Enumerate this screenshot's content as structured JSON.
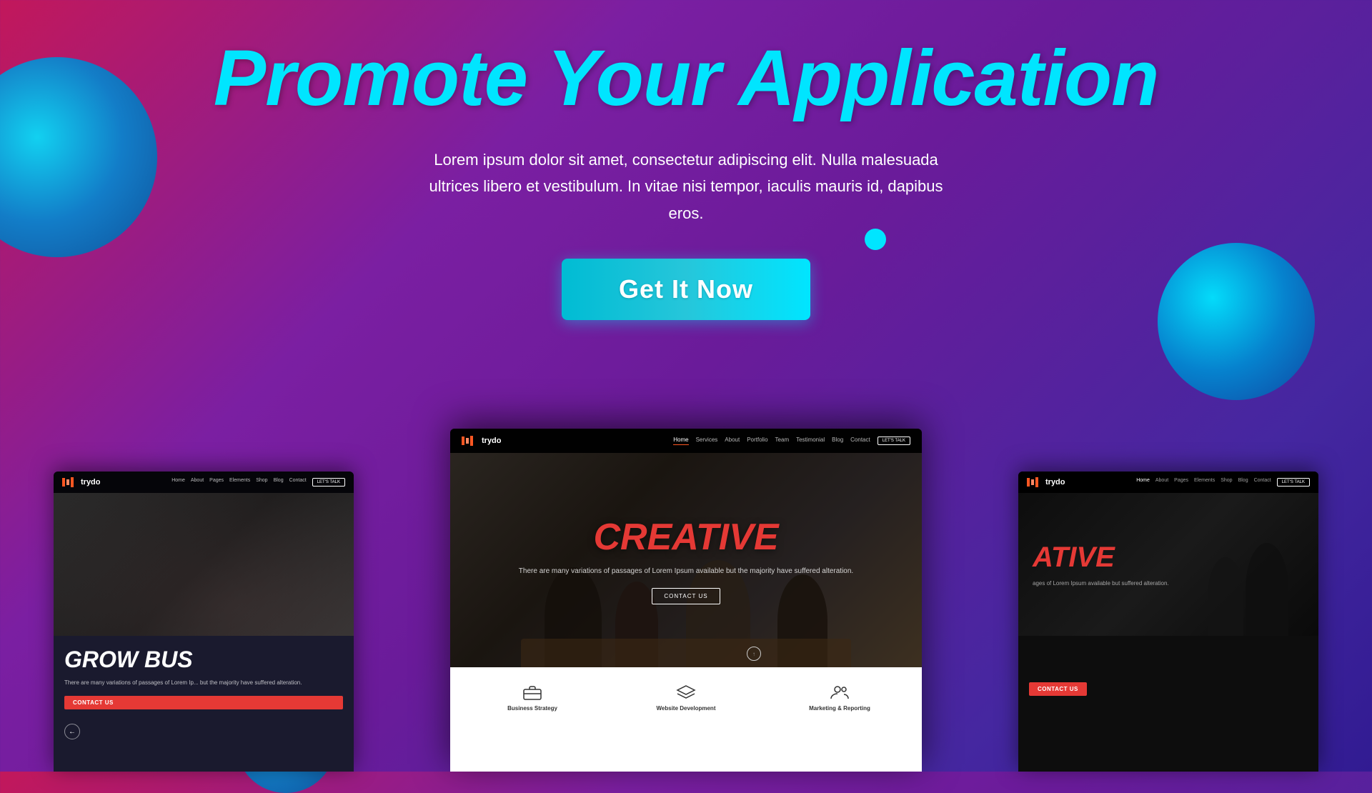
{
  "hero": {
    "title": "Promote Your Application",
    "subtitle": "Lorem ipsum dolor sit amet, consectetur adipiscing elit. Nulla malesuada ultrices libero et vestibulum. In vitae nisi tempor, iaculis mauris id, dapibus eros.",
    "cta_label": "Get It Now"
  },
  "left_screenshot": {
    "logo_text": "trydo",
    "nav_links": [
      "Home",
      "About",
      "Pages",
      "Elements",
      "Shop",
      "Blog",
      "Contact"
    ],
    "cta_nav": "LET'S TALK",
    "heading": "GROW BUS",
    "body_text": "There are many variations of passages of Lorem Ip... but the majority have suffered alteration.",
    "contact_btn": "CONTACT US"
  },
  "center_screenshot": {
    "logo_text": "trydo",
    "nav_links": [
      "Home",
      "Services",
      "About",
      "Portfolio",
      "Team",
      "Testimonial",
      "Blog",
      "Contact"
    ],
    "cta_nav": "LET'S TALK",
    "active_link": "Home",
    "heading": "CREATIVE",
    "body_text": "There are many variations of passages of Lorem Ipsum available but the majority have suffered alteration.",
    "contact_btn": "CONTACT US",
    "services": [
      {
        "label": "Business Strategy",
        "icon": "briefcase-icon"
      },
      {
        "label": "Website Development",
        "icon": "layers-icon"
      },
      {
        "label": "Marketing & Reporting",
        "icon": "users-icon"
      }
    ]
  },
  "right_screenshot": {
    "logo_text": "trydo",
    "nav_links": [
      "Home",
      "About",
      "Pages",
      "Elements",
      "Shop",
      "Blog",
      "Contact"
    ],
    "cta_nav": "LET'S TALK",
    "heading": "ATIVE",
    "body_text": "ages of Lorem Ipsum available but suffered alteration.",
    "contact_btn": "CONTACT US"
  },
  "colors": {
    "accent_cyan": "#00e5ff",
    "accent_red": "#e53935",
    "bg_purple": "#7b1fa2",
    "bg_dark": "#1a1a1a"
  }
}
